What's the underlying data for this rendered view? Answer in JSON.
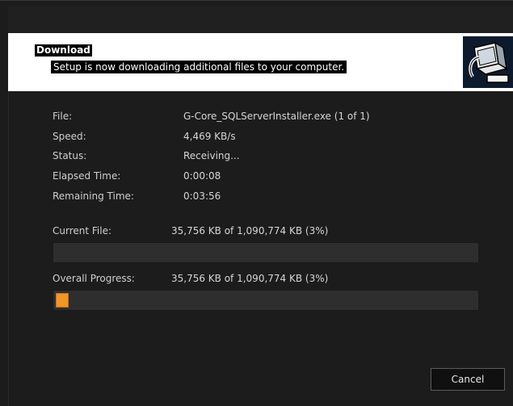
{
  "header": {
    "title": "Download",
    "subtitle": "Setup is now downloading additional files to your computer."
  },
  "details": [
    {
      "label": "File:",
      "value": "G-Core_SQLServerInstaller.exe (1 of 1)"
    },
    {
      "label": "Speed:",
      "value": "4,469 KB/s"
    },
    {
      "label": "Status:",
      "value": "Receiving..."
    },
    {
      "label": "Elapsed Time:",
      "value": "0:00:08"
    },
    {
      "label": "Remaining Time:",
      "value": "0:03:56"
    }
  ],
  "current_file": {
    "label": "Current File:",
    "value": "35,756 KB of 1,090,774 KB (3%)",
    "progress_percent": 0
  },
  "overall_progress": {
    "label": "Overall Progress:",
    "value": "35,756 KB of 1,090,774 KB (3%)",
    "progress_percent": 3
  },
  "buttons": {
    "cancel_label": "Cancel"
  },
  "colors": {
    "progress_fill": "#f0952a",
    "background": "#1c1c1c"
  },
  "icons": {
    "setup_logo": "computer-install-icon"
  }
}
